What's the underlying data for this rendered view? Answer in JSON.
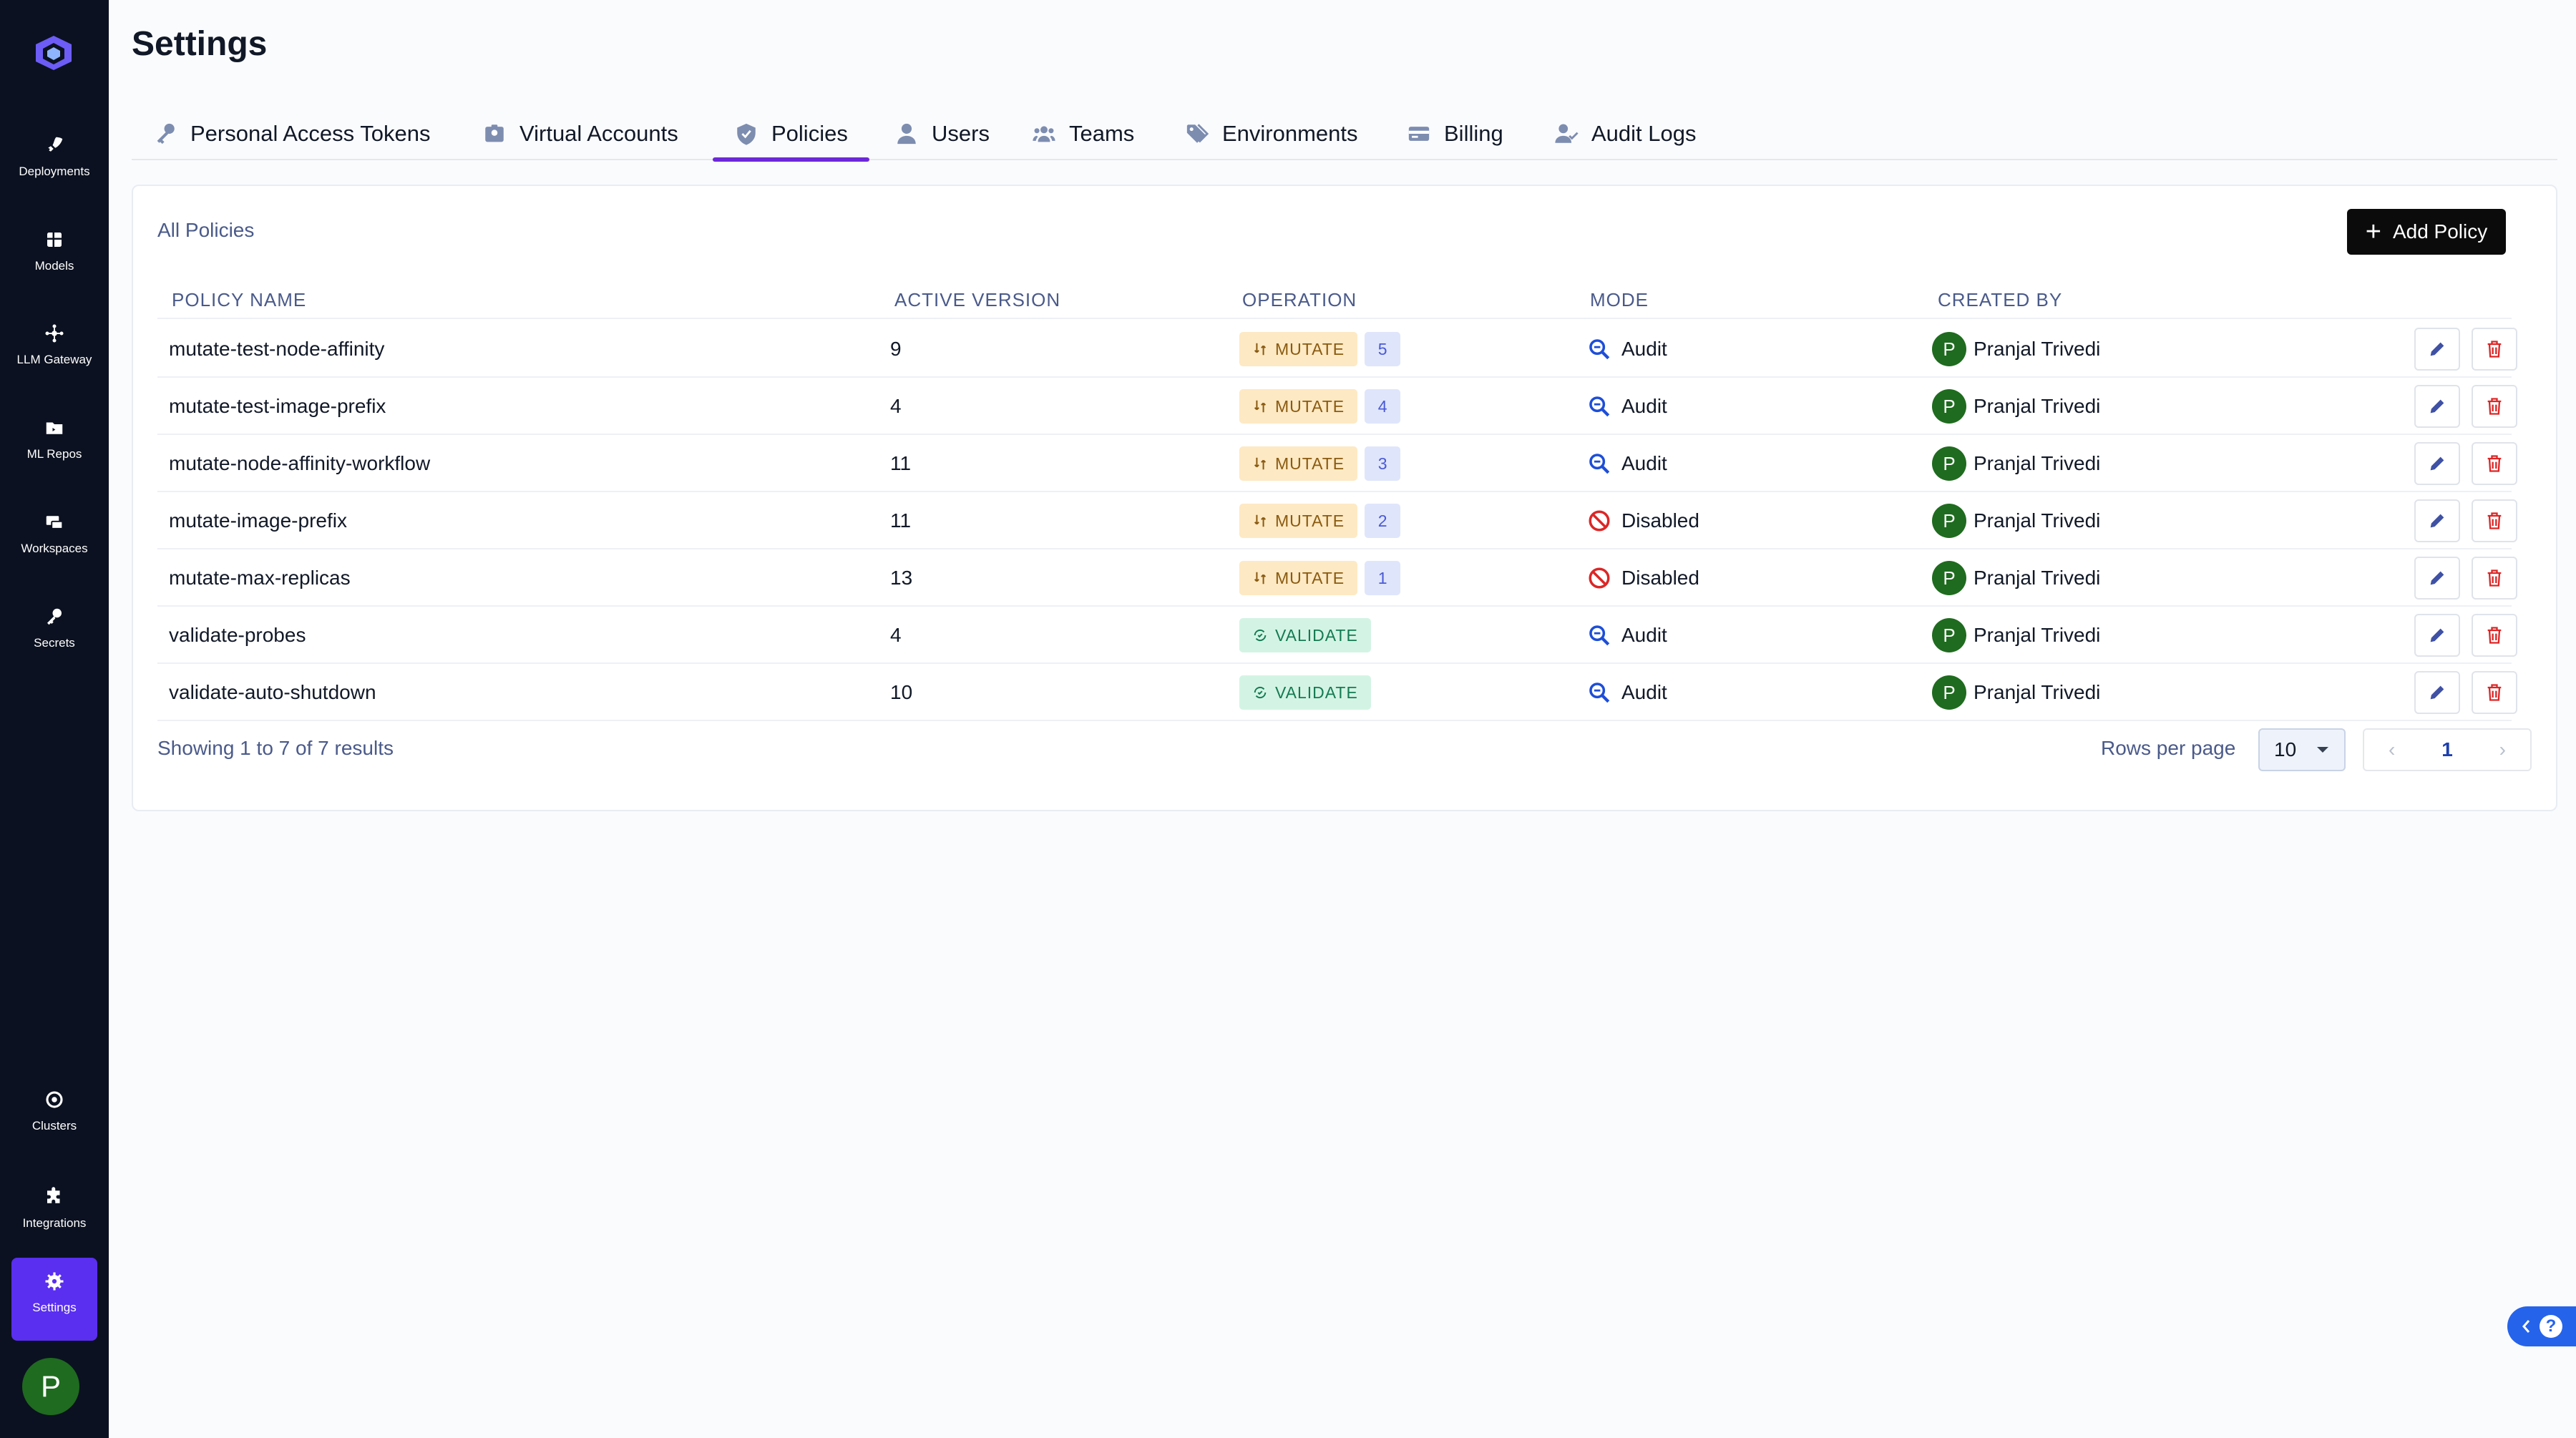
{
  "app": {
    "title": "Settings"
  },
  "sidebar": {
    "items": [
      {
        "label": "Deployments",
        "icon": "rocket-icon"
      },
      {
        "label": "Models",
        "icon": "grid-icon"
      },
      {
        "label": "LLM Gateway",
        "icon": "network-icon"
      },
      {
        "label": "ML Repos",
        "icon": "folder-icon"
      },
      {
        "label": "Workspaces",
        "icon": "workspaces-icon"
      },
      {
        "label": "Secrets",
        "icon": "key-icon"
      },
      {
        "label": "Clusters",
        "icon": "cluster-icon"
      },
      {
        "label": "Integrations",
        "icon": "puzzle-icon"
      },
      {
        "label": "Settings",
        "icon": "gear-icon",
        "active": true
      }
    ],
    "avatar_initial": "P"
  },
  "tabs": [
    {
      "label": "Personal Access Tokens",
      "icon": "key-icon"
    },
    {
      "label": "Virtual Accounts",
      "icon": "id-badge-icon"
    },
    {
      "label": "Policies",
      "icon": "shield-icon",
      "active": true
    },
    {
      "label": "Users",
      "icon": "user-icon"
    },
    {
      "label": "Teams",
      "icon": "users-icon"
    },
    {
      "label": "Environments",
      "icon": "tags-icon"
    },
    {
      "label": "Billing",
      "icon": "credit-card-icon"
    },
    {
      "label": "Audit Logs",
      "icon": "user-check-icon"
    }
  ],
  "card": {
    "title": "All Policies",
    "add_button": "Add Policy",
    "columns": [
      "POLICY NAME",
      "ACTIVE VERSION",
      "OPERATION",
      "MODE",
      "CREATED BY"
    ],
    "rows": [
      {
        "name": "mutate-test-node-affinity",
        "version": "9",
        "operation": "MUTATE",
        "count": "5",
        "mode": "Audit",
        "creator": "Pranjal Trivedi",
        "initial": "P"
      },
      {
        "name": "mutate-test-image-prefix",
        "version": "4",
        "operation": "MUTATE",
        "count": "4",
        "mode": "Audit",
        "creator": "Pranjal Trivedi",
        "initial": "P"
      },
      {
        "name": "mutate-node-affinity-workflow",
        "version": "11",
        "operation": "MUTATE",
        "count": "3",
        "mode": "Audit",
        "creator": "Pranjal Trivedi",
        "initial": "P"
      },
      {
        "name": "mutate-image-prefix",
        "version": "11",
        "operation": "MUTATE",
        "count": "2",
        "mode": "Disabled",
        "creator": "Pranjal Trivedi",
        "initial": "P"
      },
      {
        "name": "mutate-max-replicas",
        "version": "13",
        "operation": "MUTATE",
        "count": "1",
        "mode": "Disabled",
        "creator": "Pranjal Trivedi",
        "initial": "P"
      },
      {
        "name": "validate-probes",
        "version": "4",
        "operation": "VALIDATE",
        "count": "",
        "mode": "Audit",
        "creator": "Pranjal Trivedi",
        "initial": "P"
      },
      {
        "name": "validate-auto-shutdown",
        "version": "10",
        "operation": "VALIDATE",
        "count": "",
        "mode": "Audit",
        "creator": "Pranjal Trivedi",
        "initial": "P"
      }
    ],
    "footer": {
      "showing": "Showing 1 to 7 of 7 results",
      "rows_per_page_label": "Rows per page",
      "rows_per_page_value": "10",
      "current_page": "1",
      "prev": "‹",
      "next": "›"
    }
  },
  "colors": {
    "sidebar_bg": "#0b1120",
    "accent": "#5a2ff0",
    "mutate_bg": "#fde9c4",
    "validate_bg": "#d3f4e4",
    "audit_icon": "#1d4ed8",
    "disabled_icon": "#dc2626",
    "delete_icon": "#dc2626"
  }
}
